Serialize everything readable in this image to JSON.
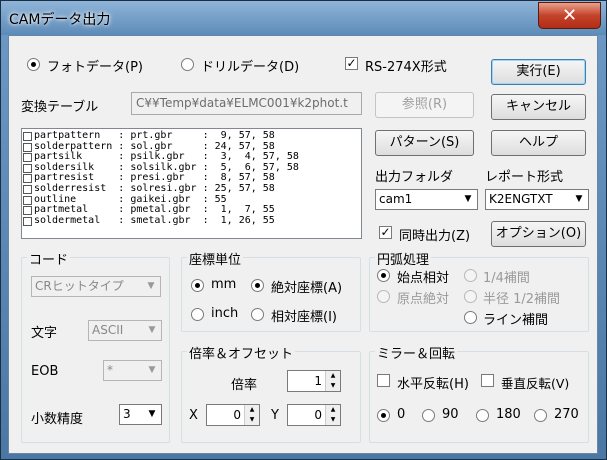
{
  "window": {
    "title": "CAMデータ出力",
    "close_glyph": "✕"
  },
  "mode": {
    "photo_label": "フォトデータ(P)",
    "drill_label": "ドリルデータ(D)",
    "rs274x_label": "RS-274X形式",
    "rs274x_checked": true
  },
  "table": {
    "label": "変換テーブル",
    "path": "C¥¥Temp¥data¥ELMC001¥k2phot.t",
    "browse_label": "参照(R)"
  },
  "layers": [
    "partpattern   : prt.gbr     :  9, 57, 58",
    "solderpattern : sol.gbr     : 24, 57, 58",
    "partsilk      : psilk.gbr   :  3,  4, 57, 58",
    "soldersilk    : solsilk.gbr :  5,  6, 57, 58",
    "partresist    : presi.gbr   :  8, 57, 58",
    "solderresist  : solresi.gbr : 25, 57, 58",
    "outline       : gaikei.gbr  : 55",
    "partmetal     : pmetal.gbr  :  1,  7, 55",
    "soldermetal   : smetal.gbr  :  1, 26, 55"
  ],
  "buttons": {
    "execute": "実行(E)",
    "cancel": "キャンセル",
    "pattern": "パターン(S)",
    "help": "ヘルプ",
    "options": "オプション(O)"
  },
  "output": {
    "folder_label": "出力フォルダ",
    "folder_value": "cam1",
    "report_label": "レポート形式",
    "report_value": "K2ENGTXT",
    "simultaneous_label": "同時出力(Z)",
    "simultaneous_checked": true
  },
  "code": {
    "group_label": "コード",
    "code_value": "CRヒットタイプ",
    "charset_label": "文字",
    "charset_value": "ASCII",
    "eob_label": "EOB",
    "eob_value": "*",
    "decimal_label": "小数精度",
    "decimal_value": "3"
  },
  "coord": {
    "group_label": "座標単位",
    "mm_label": "mm",
    "inch_label": "inch",
    "absolute_label": "絶対座標(A)",
    "relative_label": "相対座標(I)"
  },
  "arc": {
    "group_label": "円弧処理",
    "start_relative": "始点相対",
    "quarter": "1/4補間",
    "origin_absolute": "原点絶対",
    "radius_half": "半径 1/2補間",
    "line": "ライン補間"
  },
  "scale": {
    "group_label": "倍率＆オフセット",
    "ratio_label": "倍率",
    "ratio_value": "1",
    "x_label": "X",
    "x_value": "0",
    "y_label": "Y",
    "y_value": "0"
  },
  "mirror": {
    "group_label": "ミラー＆回転",
    "horizontal_label": "水平反転(H)",
    "vertical_label": "垂直反転(V)",
    "rot0": "0",
    "rot90": "90",
    "rot180": "180",
    "rot270": "270"
  },
  "colors": {
    "title_gradient_top": "#8fb4d8",
    "close_red": "#c4432a",
    "face": "#f0f0f0"
  }
}
